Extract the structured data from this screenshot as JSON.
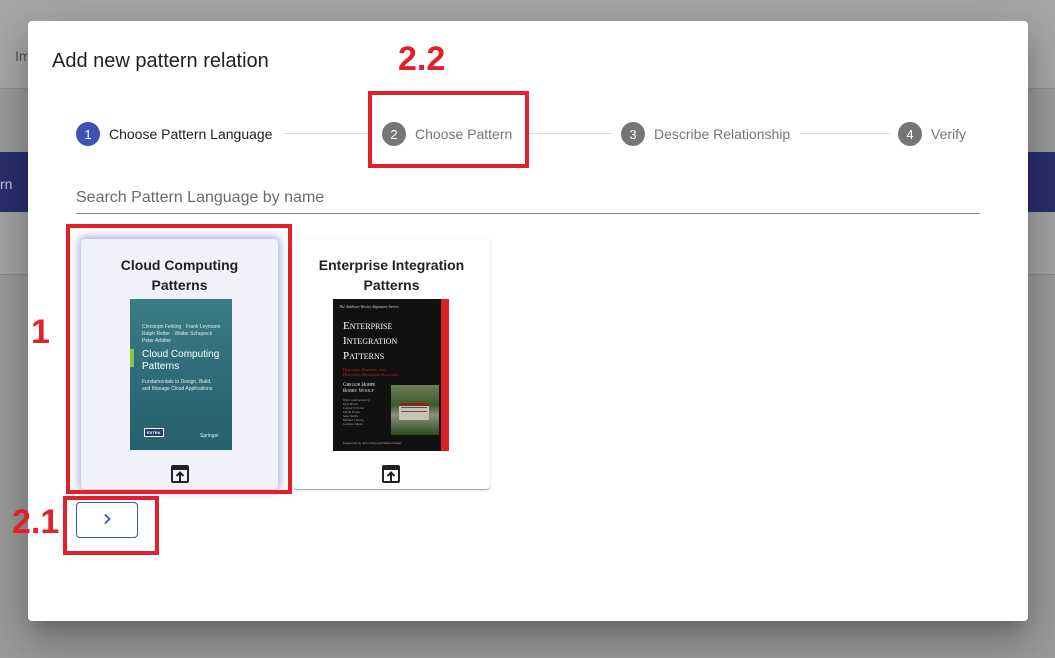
{
  "background": {
    "tab_fragment": "Im",
    "strip_fragment": "rn"
  },
  "dialog": {
    "title": "Add new pattern relation",
    "steps": [
      {
        "number": "1",
        "label": "Choose Pattern Language",
        "active": true
      },
      {
        "number": "2",
        "label": "Choose Pattern",
        "active": false
      },
      {
        "number": "3",
        "label": "Describe Relationship",
        "active": false
      },
      {
        "number": "4",
        "label": "Verify",
        "active": false
      }
    ],
    "search": {
      "placeholder": "Search Pattern Language by name",
      "value": ""
    },
    "cards": [
      {
        "title": "Cloud Computing Patterns",
        "selected": true,
        "cover": {
          "authors": [
            "Christoph Fehling · Frank Leymann",
            "Ralph Retter · Walter Schupeck",
            "Peter Arbitter"
          ],
          "title_lines": [
            "Cloud Computing",
            "Patterns"
          ],
          "subtitle_lines": [
            "Fundamentals to Design, Build,",
            "and Manage Cloud Applications"
          ],
          "badge": "EXTRA",
          "publisher": "Springer"
        }
      },
      {
        "title": "Enterprise Integration Patterns",
        "selected": false,
        "cover": {
          "series": "The Addison-Wesley Signature Series",
          "title_lines": [
            "Enterprise",
            "Integration",
            "Patterns"
          ],
          "subtitle_lines": [
            "Designing, Building, and",
            "Deploying Messaging Solutions"
          ],
          "authors": [
            "Gregor Hohpe",
            "Bobby Woolf"
          ],
          "contributors": [
            "With Contributions by",
            "Kyle Brown",
            "Conrad F. D'Cruz",
            "Martin Fowler",
            "Sean Neville",
            "Michael J. Rettig",
            "Jonathan Simon"
          ],
          "foreword": "Forewords by John Crupi and Martin Fowler"
        }
      }
    ],
    "next_button": {
      "icon": "chevron-right-icon"
    }
  },
  "annotations": [
    {
      "label": "2.2"
    },
    {
      "label": "1"
    },
    {
      "label": "2.1"
    }
  ],
  "colors": {
    "primary": "#3f51b5",
    "annotation": "#e0202a",
    "inactive_step": "#757575"
  }
}
